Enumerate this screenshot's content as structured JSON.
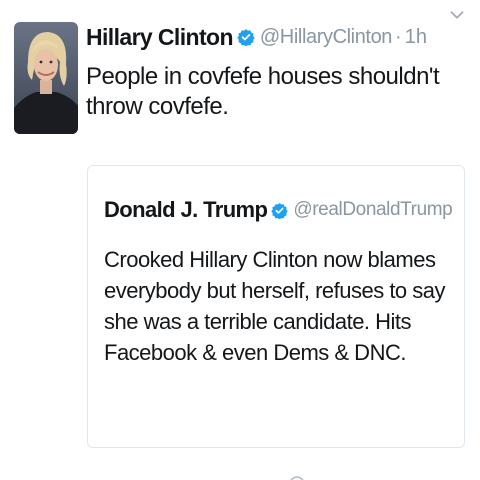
{
  "tweet": {
    "display_name": "Hillary Clinton",
    "handle": "@HillaryClinton",
    "separator": "·",
    "time": "1h",
    "text": "People in covfefe houses shouldn't throw covfefe.",
    "verified_icon": "verified-badge-icon",
    "menu_icon": "chevron-down-icon"
  },
  "quoted_tweet": {
    "display_name": "Donald J. Trump",
    "handle": "@realDonaldTrump",
    "text": "Crooked Hillary Clinton now blames everybody but herself, refuses to say she was a terrible candidate. Hits Facebook & even Dems & DNC.",
    "verified_icon": "verified-badge-icon"
  },
  "colors": {
    "verified_blue": "#1da1f2",
    "secondary_text": "#8a96a2",
    "border": "#e1e8ed"
  }
}
